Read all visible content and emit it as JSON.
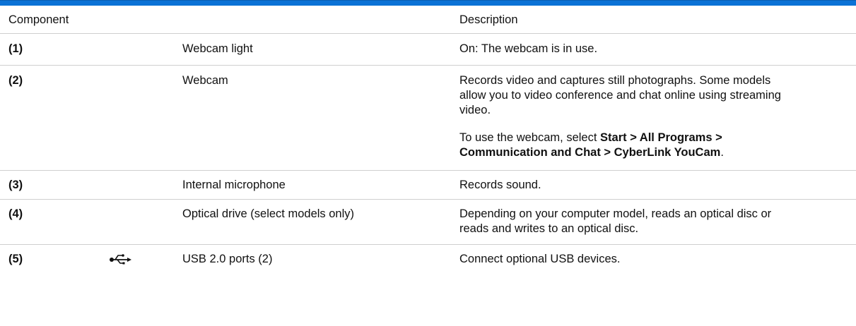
{
  "header": {
    "component": "Component",
    "description": "Description"
  },
  "rows": [
    {
      "number": "(1)",
      "component": "Webcam light",
      "description": "On: The webcam is in use."
    },
    {
      "number": "(2)",
      "component": "Webcam",
      "description": "Records video and captures still photographs. Some models allow you to video conference and chat online using streaming video.",
      "note": {
        "prefix": "To use the webcam, select ",
        "path1": "Start > All Programs >",
        "path2": "Communication and Chat > CyberLink YouCam",
        "suffix": "."
      }
    },
    {
      "number": "(3)",
      "component": "Internal microphone",
      "description": "Records sound."
    },
    {
      "number": "(4)",
      "component": "Optical drive (select models only)",
      "description": "Depending on your computer model, reads an optical disc or reads and writes to an optical disc."
    },
    {
      "number": "(5)",
      "icon": "usb-icon",
      "component": "USB 2.0 ports (2)",
      "description": "Connect optional USB devices."
    }
  ],
  "colors": {
    "accent": "#0b72d6",
    "rule": "#cfcfcf"
  }
}
